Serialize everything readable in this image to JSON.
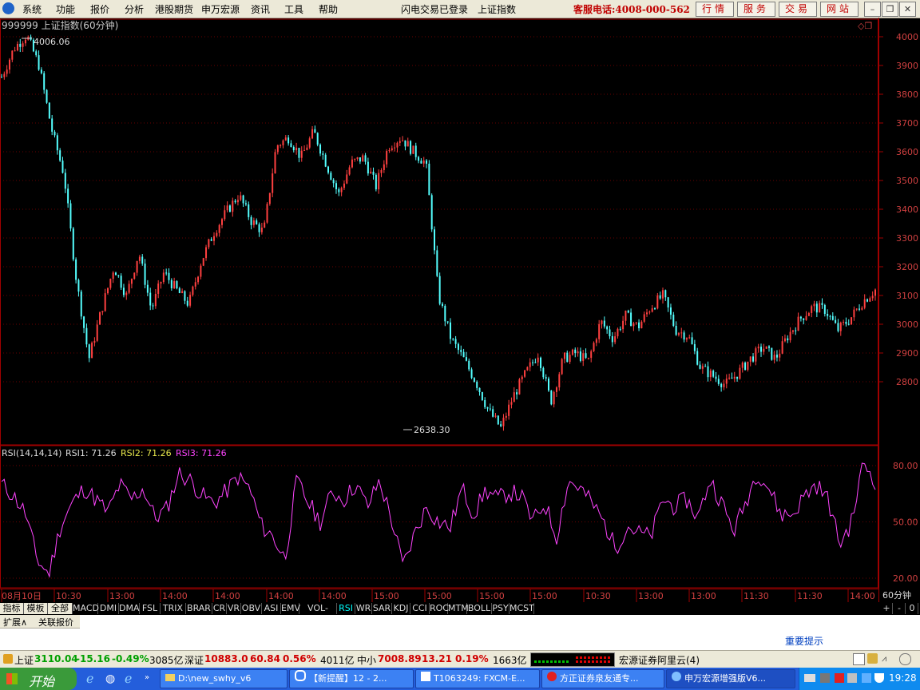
{
  "menu": {
    "items": [
      "系统",
      "功能",
      "报价",
      "分析",
      "港股期货",
      "申万宏源",
      "资讯",
      "工具",
      "帮助"
    ],
    "title_a": "闪电交易已登录",
    "title_b": "上证指数",
    "hotline": "客服电话:4008-000-562",
    "nav": [
      "行情",
      "服务",
      "交易",
      "网站"
    ]
  },
  "chart_header": "999999 上证指数(60分钟)",
  "chart_data": [
    {
      "type": "candlestick",
      "title": "999999 上证指数(60分钟)",
      "ylim": [
        2600,
        4050
      ],
      "y_ticks": [
        4000,
        3900,
        3800,
        3700,
        3600,
        3500,
        3400,
        3300,
        3200,
        3100,
        3000,
        2900,
        2800
      ],
      "annotations": [
        {
          "label": "4006.06",
          "value": 4006.06
        },
        {
          "label": "2638.30",
          "value": 2638.3
        }
      ],
      "close_path": [
        3860,
        3960,
        4006,
        3900,
        3680,
        3520,
        3150,
        2880,
        3050,
        3200,
        3100,
        3250,
        3050,
        3180,
        3120,
        3070,
        3220,
        3320,
        3390,
        3450,
        3360,
        3320,
        3620,
        3650,
        3580,
        3670,
        3560,
        3450,
        3560,
        3580,
        3480,
        3620,
        3650,
        3600,
        3560,
        3100,
        2950,
        2880,
        2800,
        2700,
        2640,
        2750,
        2830,
        2900,
        2730,
        2880,
        2900,
        2870,
        3010,
        2950,
        3030,
        2990,
        3060,
        3100,
        2980,
        2960,
        2850,
        2820,
        2790,
        2830,
        2880,
        2920,
        2880,
        2960,
        3020,
        3060,
        3050,
        2980,
        3020,
        3080,
        3120
      ]
    },
    {
      "type": "line",
      "title": "RSI(14,14,14)",
      "ylim": [
        15,
        88
      ],
      "y_ticks": [
        80,
        50,
        20
      ],
      "series": [
        {
          "name": "RSI1",
          "color": "#ff44ff",
          "values": [
            70,
            64,
            55,
            30,
            22,
            48,
            60,
            68,
            62,
            55,
            70,
            62,
            68,
            52,
            57,
            76,
            72,
            64,
            60,
            66,
            74,
            68,
            48,
            42,
            30,
            72,
            60,
            50,
            66,
            62,
            70,
            58,
            72,
            52,
            26,
            44,
            58,
            50,
            47,
            68,
            54,
            67,
            62,
            66,
            64,
            50,
            60,
            42,
            72,
            68,
            60,
            50,
            36,
            48,
            44,
            42,
            62,
            58,
            62,
            52,
            73,
            60,
            45,
            60,
            77,
            68,
            54,
            54,
            64,
            70,
            62,
            38,
            50,
            82,
            72
          ]
        }
      ],
      "x_labels": [
        "08月10日",
        "10:30",
        "13:00",
        "14:00",
        "14:00",
        "14:00",
        "14:00",
        "15:00",
        "15:00",
        "15:00",
        "15:00",
        "10:30",
        "13:00",
        "13:00",
        "11:30",
        "11:30",
        "14:00"
      ]
    }
  ],
  "rsi_header": {
    "label": "RSI(14,14,14)",
    "rsi1": "RSI1: 71.26",
    "rsi2": "RSI2: 71.26",
    "rsi3": "RSI3: 71.26"
  },
  "period_label": "60分钟",
  "tabs_left": [
    "指标",
    "模板",
    "全部"
  ],
  "indicator_tabs": [
    "MACD",
    "DMI",
    "DMA",
    "FSL",
    "TRIX",
    "BRAR",
    "CR",
    "VR",
    "OBV",
    "ASI",
    "EMV",
    "VOL-TDX",
    "RSI",
    "WR",
    "SAR",
    "KDJ",
    "CCI",
    "ROC",
    "MTM",
    "BOLL",
    "PSY",
    "MCST"
  ],
  "active_tab": "RSI",
  "tab_right": [
    "+",
    "-",
    "0"
  ],
  "subtabs": [
    "扩展∧",
    "关联报价"
  ],
  "notice": "重要提示",
  "quote_bar": {
    "sh_label": "上证",
    "sh_value": "3110.04",
    "sh_chg": "-15.16",
    "sh_pct": "-0.49%",
    "sh_amt": "3085亿",
    "sz_label": "深证",
    "sz_value": "10883.0",
    "sz_chg": "60.84",
    "sz_pct": "0.56%",
    "sz_amt": "4011亿",
    "zx_label": "中小",
    "zx_value": "7008.89",
    "zx_chg": "13.21",
    "zx_pct": "0.19%",
    "zx_amt": "1663亿",
    "server": "宏源证券阿里云(4)"
  },
  "taskbar": {
    "start": "开始",
    "tasks": [
      "D:\\new_swhy_v6",
      "【新提醒】12 - 2...",
      "T1063249: FXCM-E...",
      "方正证券泉友通专...",
      "申万宏源增强版V6..."
    ],
    "clock": "19:28"
  }
}
